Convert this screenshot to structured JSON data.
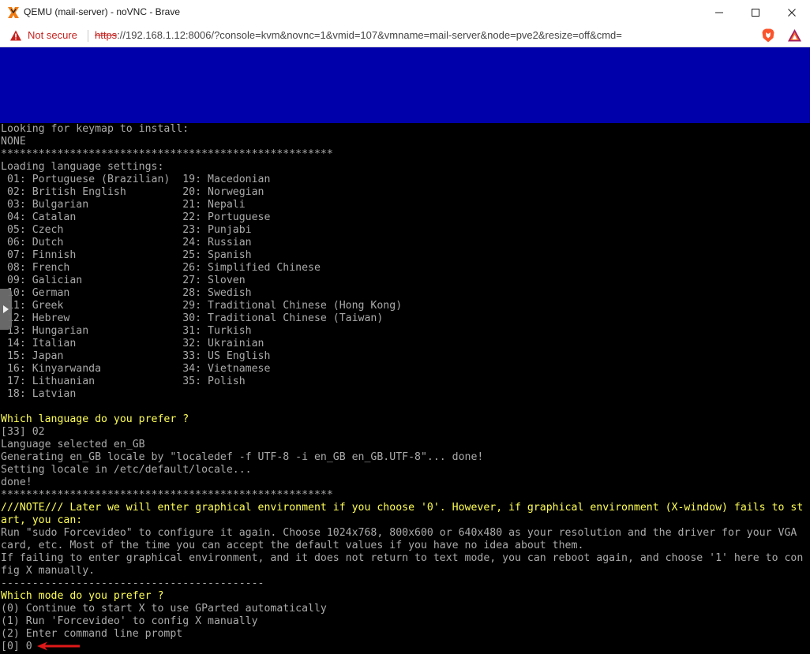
{
  "window": {
    "title": "QEMU (mail-server) - noVNC - Brave",
    "controls": {
      "minimize": "minimize-icon",
      "maximize": "maximize-icon",
      "close": "close-icon"
    }
  },
  "addressbar": {
    "security_label": "Not secure",
    "url_scheme": "https",
    "url_rest": "://192.168.1.12:8006/?console=kvm&novnc=1&vmid=107&vmname=mail-server&node=pve2&resize=off&cmd="
  },
  "colors": {
    "banner": "#0000aa",
    "terminal_text": "#aaaaaa",
    "terminal_highlight": "#ffff55",
    "warning_red": "#c5221f",
    "arrow_red": "#e01818"
  },
  "terminal": {
    "lines": [
      {
        "text": "Looking for keymap to install:",
        "hl": false
      },
      {
        "text": "NONE",
        "hl": false
      },
      {
        "text": "*****************************************************",
        "hl": false
      },
      {
        "text": "Loading language settings:",
        "hl": false
      },
      {
        "text": " 01: Portuguese (Brazilian)  19: Macedonian",
        "hl": false
      },
      {
        "text": " 02: British English         20: Norwegian",
        "hl": false
      },
      {
        "text": " 03: Bulgarian               21: Nepali",
        "hl": false
      },
      {
        "text": " 04: Catalan                 22: Portuguese",
        "hl": false
      },
      {
        "text": " 05: Czech                   23: Punjabi",
        "hl": false
      },
      {
        "text": " 06: Dutch                   24: Russian",
        "hl": false
      },
      {
        "text": " 07: Finnish                 25: Spanish",
        "hl": false
      },
      {
        "text": " 08: French                  26: Simplified Chinese",
        "hl": false
      },
      {
        "text": " 09: Galician                27: Sloven",
        "hl": false
      },
      {
        "text": " 10: German                  28: Swedish",
        "hl": false
      },
      {
        "text": " 11: Greek                   29: Traditional Chinese (Hong Kong)",
        "hl": false
      },
      {
        "text": " 12: Hebrew                  30: Traditional Chinese (Taiwan)",
        "hl": false
      },
      {
        "text": " 13: Hungarian               31: Turkish",
        "hl": false
      },
      {
        "text": " 14: Italian                 32: Ukrainian",
        "hl": false
      },
      {
        "text": " 15: Japan                   33: US English",
        "hl": false
      },
      {
        "text": " 16: Kinyarwanda             34: Vietnamese",
        "hl": false
      },
      {
        "text": " 17: Lithuanian              35: Polish",
        "hl": false
      },
      {
        "text": " 18: Latvian",
        "hl": false
      },
      {
        "text": "",
        "hl": false
      },
      {
        "text": "Which language do you prefer ?",
        "hl": true
      },
      {
        "text": "[33] 02",
        "hl": false
      },
      {
        "text": "Language selected en_GB",
        "hl": false
      },
      {
        "text": "Generating en_GB locale by \"localedef -f UTF-8 -i en_GB en_GB.UTF-8\"... done!",
        "hl": false
      },
      {
        "text": "Setting locale in /etc/default/locale...",
        "hl": false
      },
      {
        "text": "done!",
        "hl": false
      },
      {
        "text": "*****************************************************",
        "hl": false
      },
      {
        "text": "///NOTE/// Later we will enter graphical environment if you choose '0'. However, if graphical environment (X-window) fails to st",
        "hl": true
      },
      {
        "text": "art, you can:",
        "hl": true
      },
      {
        "text": "Run \"sudo Forcevideo\" to configure it again. Choose 1024x768, 800x600 or 640x480 as your resolution and the driver for your VGA",
        "hl": false
      },
      {
        "text": "card, etc. Most of the time you can accept the default values if you have no idea about them.",
        "hl": false
      },
      {
        "text": "If failing to enter graphical environment, and it does not return to text mode, you can reboot again, and choose '1' here to con",
        "hl": false
      },
      {
        "text": "fig X manually.",
        "hl": false
      },
      {
        "text": "------------------------------------------",
        "hl": false
      },
      {
        "text": "Which mode do you prefer ?",
        "hl": true
      },
      {
        "text": "(0) Continue to start X to use GParted automatically",
        "hl": false
      },
      {
        "text": "(1) Run 'Forcevideo' to config X manually",
        "hl": false
      },
      {
        "text": "(2) Enter command line prompt",
        "hl": false
      },
      {
        "text": "[0] 0",
        "hl": false
      }
    ]
  }
}
